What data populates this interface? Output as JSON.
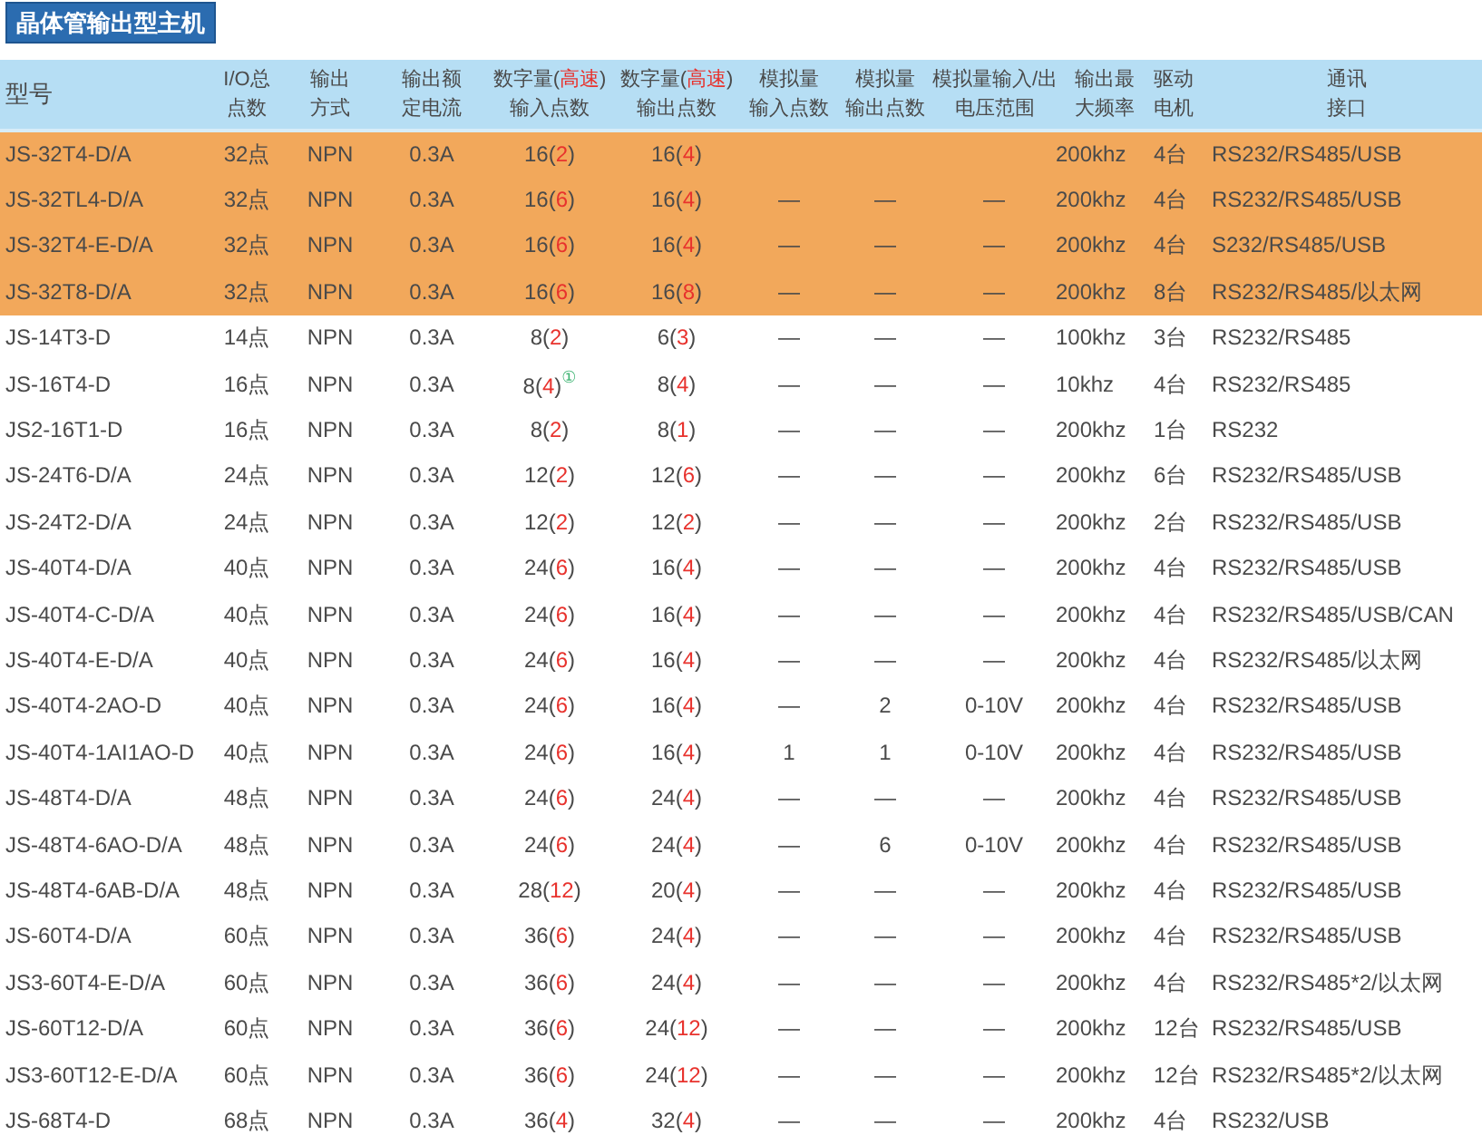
{
  "title": "晶体管输出型主机",
  "columns": [
    {
      "lines": [
        [
          {
            "t": "型号"
          }
        ]
      ]
    },
    {
      "lines": [
        [
          {
            "t": "I/O总"
          }
        ],
        [
          {
            "t": "点数"
          }
        ]
      ]
    },
    {
      "lines": [
        [
          {
            "t": "输出"
          }
        ],
        [
          {
            "t": "方式"
          }
        ]
      ]
    },
    {
      "lines": [
        [
          {
            "t": "输出额"
          }
        ],
        [
          {
            "t": "定电流"
          }
        ]
      ]
    },
    {
      "lines": [
        [
          {
            "t": "数字量("
          },
          {
            "t": "高速",
            "red": true
          },
          {
            "t": ")"
          }
        ],
        [
          {
            "t": "输入点数"
          }
        ]
      ]
    },
    {
      "lines": [
        [
          {
            "t": "数字量("
          },
          {
            "t": "高速",
            "red": true
          },
          {
            "t": ")"
          }
        ],
        [
          {
            "t": "输出点数"
          }
        ]
      ]
    },
    {
      "lines": [
        [
          {
            "t": "模拟量"
          }
        ],
        [
          {
            "t": "输入点数"
          }
        ]
      ]
    },
    {
      "lines": [
        [
          {
            "t": "模拟量"
          }
        ],
        [
          {
            "t": "输出点数"
          }
        ]
      ]
    },
    {
      "lines": [
        [
          {
            "t": "模拟量输入/出"
          }
        ],
        [
          {
            "t": "电压范围"
          }
        ]
      ]
    },
    {
      "lines": [
        [
          {
            "t": "输出最"
          }
        ],
        [
          {
            "t": "大频率"
          }
        ]
      ]
    },
    {
      "lines": [
        [
          {
            "t": "驱动"
          }
        ],
        [
          {
            "t": "电机"
          }
        ]
      ]
    },
    {
      "lines": [
        [
          {
            "t": "通讯"
          }
        ],
        [
          {
            "t": "接口"
          }
        ]
      ]
    }
  ],
  "rows": [
    {
      "highlighted": true,
      "cells": [
        "JS-32T4-D/A",
        "32点",
        "NPN",
        "0.3A",
        [
          {
            "t": "16("
          },
          {
            "t": "2",
            "red": true
          },
          {
            "t": ")"
          }
        ],
        [
          {
            "t": "16("
          },
          {
            "t": "4",
            "red": true
          },
          {
            "t": ")"
          }
        ],
        null,
        null,
        null,
        "200khz",
        "4台",
        "RS232/RS485/USB"
      ]
    },
    {
      "highlighted": true,
      "cells": [
        "JS-32TL4-D/A",
        "32点",
        "NPN",
        "0.3A",
        [
          {
            "t": "16("
          },
          {
            "t": "6",
            "red": true
          },
          {
            "t": ")"
          }
        ],
        [
          {
            "t": "16("
          },
          {
            "t": "4",
            "red": true
          },
          {
            "t": ")"
          }
        ],
        "—",
        "—",
        "—",
        "200khz",
        "4台",
        "RS232/RS485/USB"
      ]
    },
    {
      "highlighted": true,
      "cells": [
        "JS-32T4-E-D/A",
        "32点",
        "NPN",
        "0.3A",
        [
          {
            "t": "16("
          },
          {
            "t": "6",
            "red": true
          },
          {
            "t": ")"
          }
        ],
        [
          {
            "t": "16("
          },
          {
            "t": "4",
            "red": true
          },
          {
            "t": ")"
          }
        ],
        "—",
        "—",
        "—",
        "200khz",
        "4台",
        "S232/RS485/USB"
      ]
    },
    {
      "highlighted": true,
      "cells": [
        "JS-32T8-D/A",
        "32点",
        "NPN",
        "0.3A",
        [
          {
            "t": "16("
          },
          {
            "t": "6",
            "red": true
          },
          {
            "t": ")"
          }
        ],
        [
          {
            "t": "16("
          },
          {
            "t": "8",
            "red": true
          },
          {
            "t": ")"
          }
        ],
        "—",
        "—",
        "—",
        "200khz",
        "8台",
        "RS232/RS485/以太网"
      ]
    },
    {
      "highlighted": false,
      "cells": [
        "JS-14T3-D",
        "14点",
        "NPN",
        "0.3A",
        [
          {
            "t": "8("
          },
          {
            "t": "2",
            "red": true
          },
          {
            "t": ")"
          }
        ],
        [
          {
            "t": "6("
          },
          {
            "t": "3",
            "red": true
          },
          {
            "t": ")"
          }
        ],
        "—",
        "—",
        "—",
        "100khz",
        "3台",
        "RS232/RS485"
      ]
    },
    {
      "highlighted": false,
      "cells": [
        "JS-16T4-D",
        "16点",
        "NPN",
        "0.3A",
        [
          {
            "t": "8("
          },
          {
            "t": "4",
            "red": true
          },
          {
            "t": ")"
          },
          {
            "t": "①",
            "note": true
          }
        ],
        [
          {
            "t": "8("
          },
          {
            "t": "4",
            "red": true
          },
          {
            "t": ")"
          }
        ],
        "—",
        "—",
        "—",
        "10khz",
        "4台",
        "RS232/RS485"
      ]
    },
    {
      "highlighted": false,
      "cells": [
        "JS2-16T1-D",
        "16点",
        "NPN",
        "0.3A",
        [
          {
            "t": "8("
          },
          {
            "t": "2",
            "red": true
          },
          {
            "t": ")"
          }
        ],
        [
          {
            "t": "8("
          },
          {
            "t": "1",
            "red": true
          },
          {
            "t": ")"
          }
        ],
        "—",
        "—",
        "—",
        "200khz",
        "1台",
        "RS232"
      ]
    },
    {
      "highlighted": false,
      "cells": [
        "JS-24T6-D/A",
        "24点",
        "NPN",
        "0.3A",
        [
          {
            "t": "12("
          },
          {
            "t": "2",
            "red": true
          },
          {
            "t": ")"
          }
        ],
        [
          {
            "t": "12("
          },
          {
            "t": "6",
            "red": true
          },
          {
            "t": ")"
          }
        ],
        "—",
        "—",
        "—",
        "200khz",
        "6台",
        "RS232/RS485/USB"
      ]
    },
    {
      "highlighted": false,
      "cells": [
        "JS-24T2-D/A",
        "24点",
        "NPN",
        "0.3A",
        [
          {
            "t": "12("
          },
          {
            "t": "2",
            "red": true
          },
          {
            "t": ")"
          }
        ],
        [
          {
            "t": "12("
          },
          {
            "t": "2",
            "red": true
          },
          {
            "t": ")"
          }
        ],
        "—",
        "—",
        "—",
        "200khz",
        "2台",
        "RS232/RS485/USB"
      ]
    },
    {
      "highlighted": false,
      "cells": [
        "JS-40T4-D/A",
        "40点",
        "NPN",
        "0.3A",
        [
          {
            "t": "24("
          },
          {
            "t": "6",
            "red": true
          },
          {
            "t": ")"
          }
        ],
        [
          {
            "t": "16("
          },
          {
            "t": "4",
            "red": true
          },
          {
            "t": ")"
          }
        ],
        "—",
        "—",
        "—",
        "200khz",
        "4台",
        "RS232/RS485/USB"
      ]
    },
    {
      "highlighted": false,
      "cells": [
        "JS-40T4-C-D/A",
        "40点",
        "NPN",
        "0.3A",
        [
          {
            "t": "24("
          },
          {
            "t": "6",
            "red": true
          },
          {
            "t": ")"
          }
        ],
        [
          {
            "t": "16("
          },
          {
            "t": "4",
            "red": true
          },
          {
            "t": ")"
          }
        ],
        "—",
        "—",
        "—",
        "200khz",
        "4台",
        "RS232/RS485/USB/CAN"
      ]
    },
    {
      "highlighted": false,
      "cells": [
        "JS-40T4-E-D/A",
        "40点",
        "NPN",
        "0.3A",
        [
          {
            "t": "24("
          },
          {
            "t": "6",
            "red": true
          },
          {
            "t": ")"
          }
        ],
        [
          {
            "t": "16("
          },
          {
            "t": "4",
            "red": true
          },
          {
            "t": ")"
          }
        ],
        "—",
        "—",
        "—",
        "200khz",
        "4台",
        "RS232/RS485/以太网"
      ]
    },
    {
      "highlighted": false,
      "cells": [
        "JS-40T4-2AO-D",
        "40点",
        "NPN",
        "0.3A",
        [
          {
            "t": "24("
          },
          {
            "t": "6",
            "red": true
          },
          {
            "t": ")"
          }
        ],
        [
          {
            "t": "16("
          },
          {
            "t": "4",
            "red": true
          },
          {
            "t": ")"
          }
        ],
        "—",
        "2",
        "0-10V",
        "200khz",
        "4台",
        "RS232/RS485/USB"
      ]
    },
    {
      "highlighted": false,
      "cells": [
        "JS-40T4-1AI1AO-D",
        "40点",
        "NPN",
        "0.3A",
        [
          {
            "t": "24("
          },
          {
            "t": "6",
            "red": true
          },
          {
            "t": ")"
          }
        ],
        [
          {
            "t": "16("
          },
          {
            "t": "4",
            "red": true
          },
          {
            "t": ")"
          }
        ],
        "1",
        "1",
        "0-10V",
        "200khz",
        "4台",
        "RS232/RS485/USB"
      ]
    },
    {
      "highlighted": false,
      "cells": [
        "JS-48T4-D/A",
        "48点",
        "NPN",
        "0.3A",
        [
          {
            "t": "24("
          },
          {
            "t": "6",
            "red": true
          },
          {
            "t": ")"
          }
        ],
        [
          {
            "t": "24("
          },
          {
            "t": "4",
            "red": true
          },
          {
            "t": ")"
          }
        ],
        "—",
        "—",
        "—",
        "200khz",
        "4台",
        "RS232/RS485/USB"
      ]
    },
    {
      "highlighted": false,
      "cells": [
        "JS-48T4-6AO-D/A",
        "48点",
        "NPN",
        "0.3A",
        [
          {
            "t": "24("
          },
          {
            "t": "6",
            "red": true
          },
          {
            "t": ")"
          }
        ],
        [
          {
            "t": "24("
          },
          {
            "t": "4",
            "red": true
          },
          {
            "t": ")"
          }
        ],
        "—",
        "6",
        "0-10V",
        "200khz",
        "4台",
        "RS232/RS485/USB"
      ]
    },
    {
      "highlighted": false,
      "cells": [
        "JS-48T4-6AB-D/A",
        "48点",
        "NPN",
        "0.3A",
        [
          {
            "t": "28("
          },
          {
            "t": "12",
            "red": true
          },
          {
            "t": ")"
          }
        ],
        [
          {
            "t": "20("
          },
          {
            "t": "4",
            "red": true
          },
          {
            "t": ")"
          }
        ],
        "—",
        "—",
        "—",
        "200khz",
        "4台",
        "RS232/RS485/USB"
      ]
    },
    {
      "highlighted": false,
      "cells": [
        "JS-60T4-D/A",
        "60点",
        "NPN",
        "0.3A",
        [
          {
            "t": "36("
          },
          {
            "t": "6",
            "red": true
          },
          {
            "t": ")"
          }
        ],
        [
          {
            "t": "24("
          },
          {
            "t": "4",
            "red": true
          },
          {
            "t": ")"
          }
        ],
        "—",
        "—",
        "—",
        "200khz",
        "4台",
        "RS232/RS485/USB"
      ]
    },
    {
      "highlighted": false,
      "cells": [
        "JS3-60T4-E-D/A",
        "60点",
        "NPN",
        "0.3A",
        [
          {
            "t": "36("
          },
          {
            "t": "6",
            "red": true
          },
          {
            "t": ")"
          }
        ],
        [
          {
            "t": "24("
          },
          {
            "t": "4",
            "red": true
          },
          {
            "t": ")"
          }
        ],
        "—",
        "—",
        "—",
        "200khz",
        "4台",
        "RS232/RS485*2/以太网"
      ]
    },
    {
      "highlighted": false,
      "cells": [
        "JS-60T12-D/A",
        "60点",
        "NPN",
        "0.3A",
        [
          {
            "t": "36("
          },
          {
            "t": "6",
            "red": true
          },
          {
            "t": ")"
          }
        ],
        [
          {
            "t": "24("
          },
          {
            "t": "12",
            "red": true
          },
          {
            "t": ")"
          }
        ],
        "—",
        "—",
        "—",
        "200khz",
        "12台",
        "RS232/RS485/USB"
      ]
    },
    {
      "highlighted": false,
      "cells": [
        "JS3-60T12-E-D/A",
        "60点",
        "NPN",
        "0.3A",
        [
          {
            "t": "36("
          },
          {
            "t": "6",
            "red": true
          },
          {
            "t": ")"
          }
        ],
        [
          {
            "t": "24("
          },
          {
            "t": "12",
            "red": true
          },
          {
            "t": ")"
          }
        ],
        "—",
        "—",
        "—",
        "200khz",
        "12台",
        "RS232/RS485*2/以太网"
      ]
    },
    {
      "highlighted": false,
      "cells": [
        "JS-68T4-D",
        "68点",
        "NPN",
        "0.3A",
        [
          {
            "t": "36("
          },
          {
            "t": "4",
            "red": true
          },
          {
            "t": ")"
          }
        ],
        [
          {
            "t": "32("
          },
          {
            "t": "4",
            "red": true
          },
          {
            "t": ")"
          }
        ],
        "—",
        "—",
        "—",
        "200khz",
        "4台",
        "RS232/USB"
      ]
    }
  ]
}
